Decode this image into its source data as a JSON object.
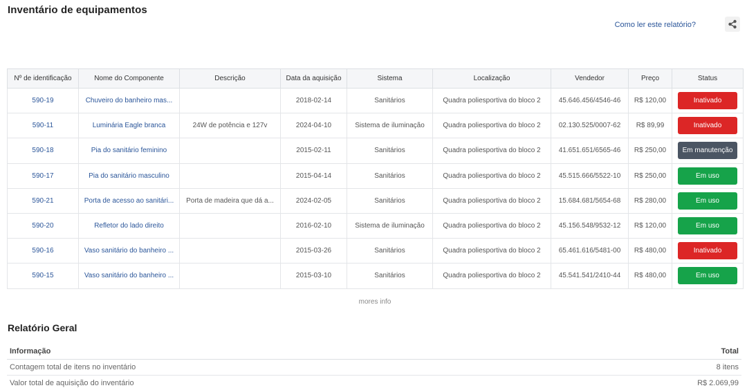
{
  "header": {
    "title": "Inventário de equipamentos",
    "help_link": "Como ler este relatório?",
    "share_icon": "share-icon"
  },
  "table": {
    "columns": [
      "Nº de identificação",
      "Nome do Componente",
      "Descrição",
      "Data da aquisição",
      "Sistema",
      "Localização",
      "Vendedor",
      "Preço",
      "Status"
    ],
    "rows": [
      {
        "id": "590-19",
        "name": "Chuveiro do banheiro mas...",
        "desc": "",
        "date": "2018-02-14",
        "system": "Sanitários",
        "location": "Quadra poliesportiva do bloco 2",
        "vendor": "45.646.456/4546-46",
        "price": "R$ 120,00",
        "status": "Inativado",
        "status_color": "#dc2626"
      },
      {
        "id": "590-11",
        "name": "Luminária Eagle branca",
        "desc": "24W de potência e 127v",
        "date": "2024-04-10",
        "system": "Sistema de iluminação",
        "location": "Quadra poliesportiva do bloco 2",
        "vendor": "02.130.525/0007-62",
        "price": "R$ 89,99",
        "status": "Inativado",
        "status_color": "#dc2626"
      },
      {
        "id": "590-18",
        "name": "Pia do sanitário feminino",
        "desc": "",
        "date": "2015-02-11",
        "system": "Sanitários",
        "location": "Quadra poliesportiva do bloco 2",
        "vendor": "41.651.651/6565-46",
        "price": "R$ 250,00",
        "status": "Em manutenção",
        "status_color": "#4b5563"
      },
      {
        "id": "590-17",
        "name": "Pia do sanitário masculino",
        "desc": "",
        "date": "2015-04-14",
        "system": "Sanitários",
        "location": "Quadra poliesportiva do bloco 2",
        "vendor": "45.515.666/5522-10",
        "price": "R$ 250,00",
        "status": "Em uso",
        "status_color": "#16a34a"
      },
      {
        "id": "590-21",
        "name": "Porta de acesso ao sanitári...",
        "desc": "Porta de madeira que dá a...",
        "date": "2024-02-05",
        "system": "Sanitários",
        "location": "Quadra poliesportiva do bloco 2",
        "vendor": "15.684.681/5654-68",
        "price": "R$ 280,00",
        "status": "Em uso",
        "status_color": "#16a34a"
      },
      {
        "id": "590-20",
        "name": "Refletor do lado direito",
        "desc": "",
        "date": "2016-02-10",
        "system": "Sistema de iluminação",
        "location": "Quadra poliesportiva do bloco 2",
        "vendor": "45.156.548/9532-12",
        "price": "R$ 120,00",
        "status": "Em uso",
        "status_color": "#16a34a"
      },
      {
        "id": "590-16",
        "name": "Vaso sanitário do banheiro ...",
        "desc": "",
        "date": "2015-03-26",
        "system": "Sanitários",
        "location": "Quadra poliesportiva do bloco 2",
        "vendor": "65.461.616/5481-00",
        "price": "R$ 480,00",
        "status": "Inativado",
        "status_color": "#dc2626"
      },
      {
        "id": "590-15",
        "name": "Vaso sanitário do banheiro ...",
        "desc": "",
        "date": "2015-03-10",
        "system": "Sanitários",
        "location": "Quadra poliesportiva do bloco 2",
        "vendor": "45.541.541/2410-44",
        "price": "R$ 480,00",
        "status": "Em uso",
        "status_color": "#16a34a"
      }
    ]
  },
  "more_info": "mores info",
  "summary": {
    "title": "Relatório Geral",
    "col_info": "Informação",
    "col_total": "Total",
    "rows": [
      {
        "label": "Contagem total de itens no inventário",
        "value": "8 itens"
      },
      {
        "label": "Valor total de aquisição do inventário",
        "value": "R$ 2.069,99"
      }
    ]
  }
}
